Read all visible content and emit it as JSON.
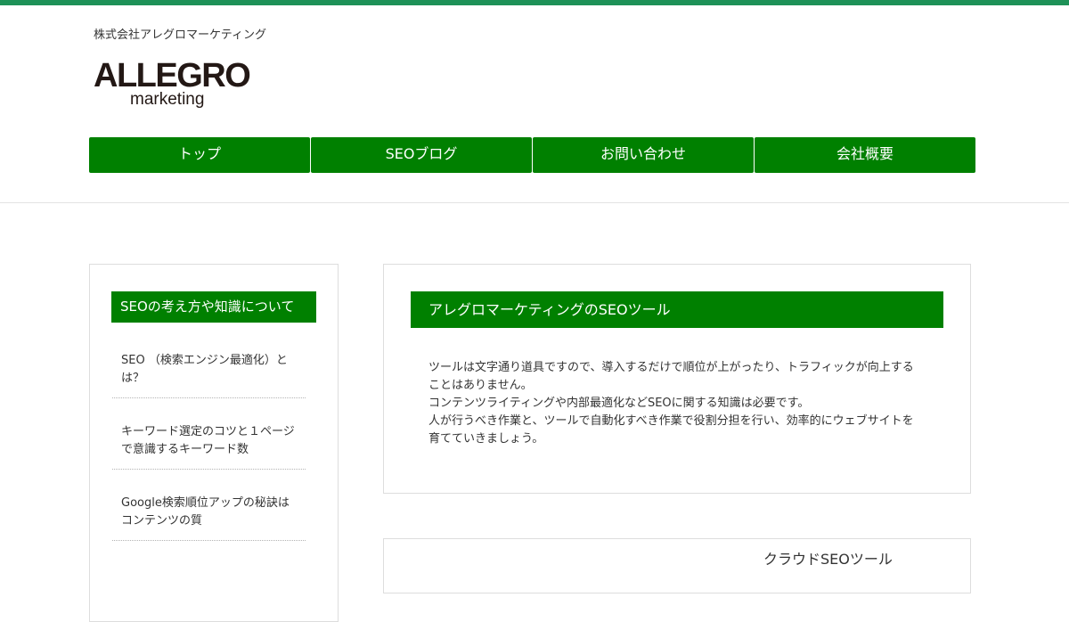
{
  "colors": {
    "top_bar": "#1e9157",
    "nav_green": "#008000",
    "logo_text": "#231815",
    "text": "#333333",
    "border": "#dddddd"
  },
  "header": {
    "company_name": "株式会社アレグロマーケティング",
    "logo": {
      "main": "ALLEGRO",
      "sub": "marketing"
    }
  },
  "nav": {
    "items": [
      {
        "label": "トップ"
      },
      {
        "label": "SEOブログ"
      },
      {
        "label": "お問い合わせ"
      },
      {
        "label": "会社概要"
      }
    ]
  },
  "sidebar": {
    "heading": "SEOの考え方や知識について",
    "items": [
      {
        "label": "SEO （検索エンジン最適化）とは？"
      },
      {
        "label": "キーワード選定のコツと１ページで意識するキーワード数"
      },
      {
        "label": "Google検索順位アップの秘訣はコンテンツの質"
      }
    ]
  },
  "main": {
    "card1": {
      "heading": "アレグロマーケティングのSEOツール",
      "paragraphs": [
        "ツールは文字通り道具ですので、導入するだけで順位が上がったり、トラフィックが向上することはありません。",
        "コンテンツライティングや内部最適化などSEOに関する知識は必要です。",
        "人が行うべき作業と、ツールで自動化すべき作業で役割分担を行い、効率的にウェブサイトを育てていきましょう。"
      ]
    },
    "card2": {
      "heading": "クラウドSEOツール"
    }
  }
}
